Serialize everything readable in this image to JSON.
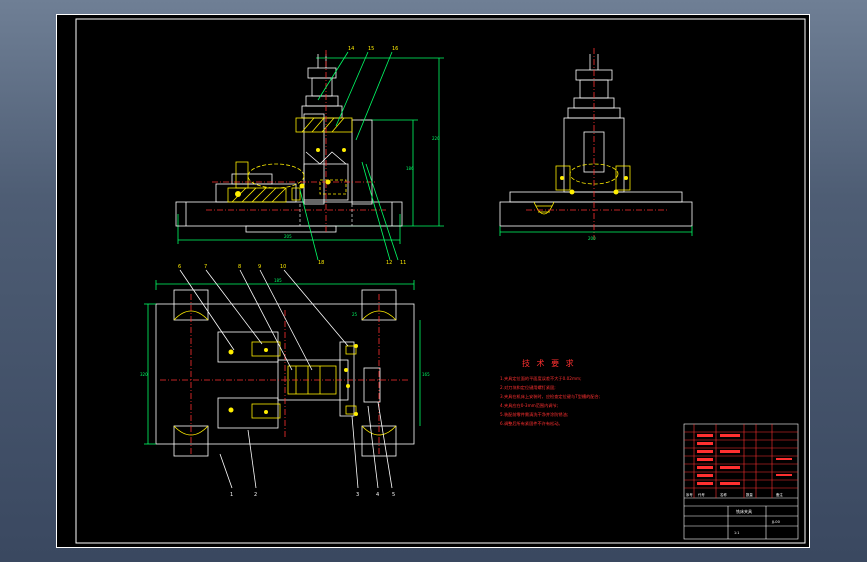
{
  "drawing": {
    "tech_requirements": {
      "title": "技 术 要 求",
      "lines": [
        "1.夹具定位面的平面度误差不大于0.02mm;",
        "2.对刀块和定位键用螺钉紧固;",
        "3.夹具在机床上安装时，应检查定位键与T型槽的配合;",
        "4.夹具应在0-3mm范围内调节;",
        "5.装配前零件需清洗干净并涂防锈油;",
        "6.调整后所有紧固件不许有松动。"
      ]
    },
    "front_view": {
      "leader_numbers": [
        "14",
        "15",
        "16",
        "18",
        "12",
        "11"
      ],
      "dim_labels": [
        "205",
        "186",
        "220"
      ]
    },
    "side_view": {
      "dim_labels": [
        "200"
      ]
    },
    "plan_view": {
      "leader_numbers_top": [
        "6",
        "7",
        "8",
        "9",
        "10"
      ],
      "leader_numbers_bottom": [
        "1",
        "2",
        "3",
        "4",
        "5"
      ],
      "dim_labels": [
        "320",
        "185",
        "165",
        "25"
      ]
    },
    "title_block": {
      "part_name": "铣床夹具",
      "drawing_no": "JJ-00",
      "header_cells": [
        "序号",
        "代号",
        "名称",
        "数量",
        "备注"
      ],
      "scale": "1:1"
    }
  }
}
